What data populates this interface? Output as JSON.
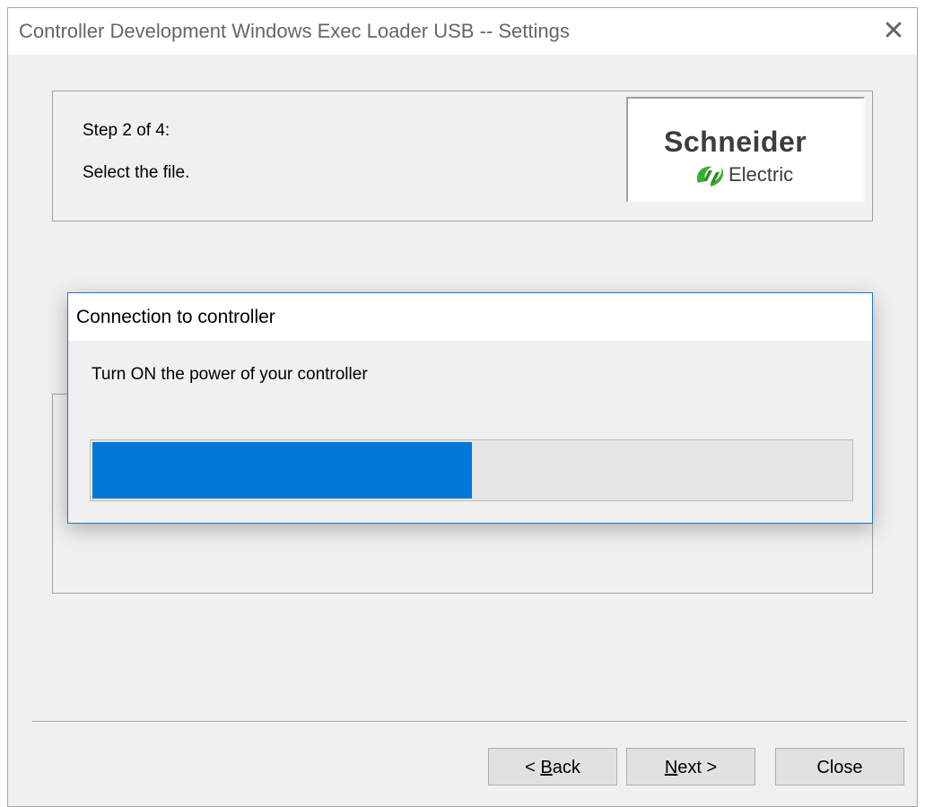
{
  "window": {
    "title": "Controller Development Windows Exec Loader USB -- Settings",
    "close_icon": "close-icon"
  },
  "header": {
    "step": "Step 2 of 4:",
    "description": "Select the file.",
    "logo": {
      "line1": "Schneider",
      "line2": "Electric"
    }
  },
  "footer": {
    "back": {
      "accel": "B",
      "rest": "ack",
      "prefix": "< "
    },
    "next": {
      "accel": "N",
      "rest": "ext >"
    },
    "close": "Close"
  },
  "dialog": {
    "title": "Connection to controller",
    "message": "Turn ON the power of your controller",
    "progress_fraction": 0.5
  },
  "colors": {
    "accent": "#0078d7",
    "dialog_border": "#1979ca",
    "logo_green": "#3dab34"
  }
}
